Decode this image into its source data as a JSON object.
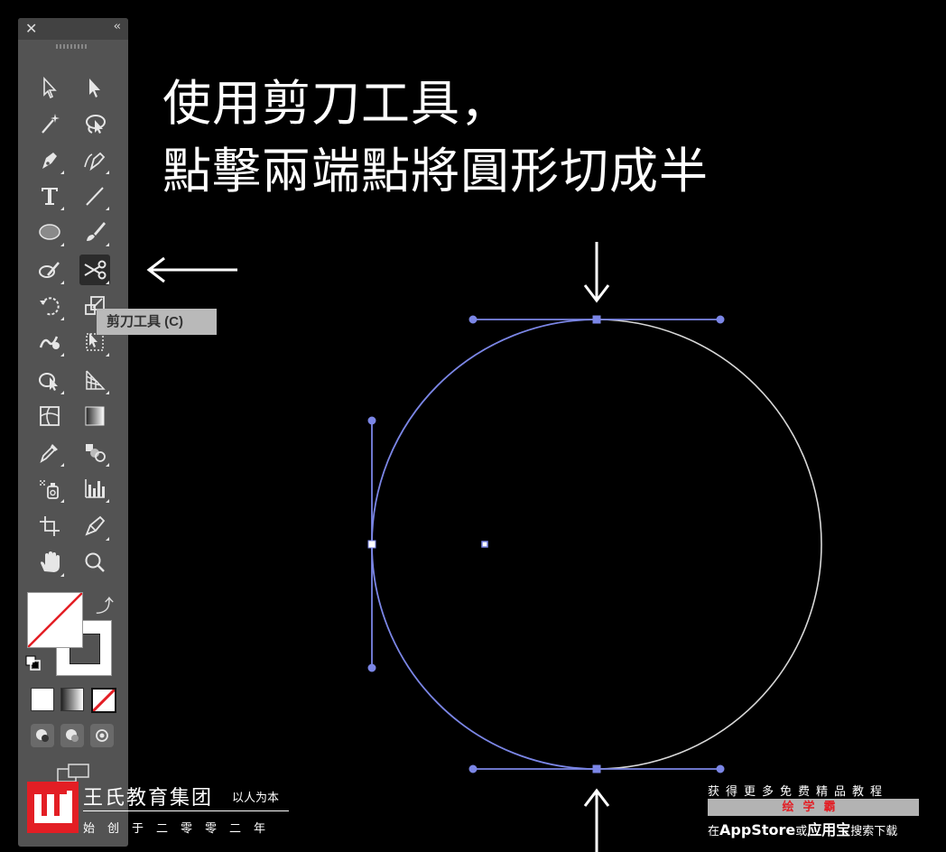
{
  "toolbar": {
    "close_glyph": "✕",
    "collapse_glyph": "‹‹",
    "tools": [
      {
        "name": "selection-tool",
        "icon": "arrow-outline-icon"
      },
      {
        "name": "direct-selection-tool",
        "icon": "arrow-solid-icon"
      },
      {
        "name": "magic-wand-tool",
        "icon": "magic-wand-icon"
      },
      {
        "name": "lasso-tool",
        "icon": "lasso-icon"
      },
      {
        "name": "pen-tool",
        "icon": "pen-icon"
      },
      {
        "name": "curvature-tool",
        "icon": "curvature-pen-icon"
      },
      {
        "name": "type-tool",
        "icon": "type-icon"
      },
      {
        "name": "line-tool",
        "icon": "line-icon"
      },
      {
        "name": "ellipse-tool",
        "icon": "ellipse-icon"
      },
      {
        "name": "paintbrush-tool",
        "icon": "paintbrush-icon"
      },
      {
        "name": "shaper-tool",
        "icon": "shaper-icon"
      },
      {
        "name": "scissors-tool",
        "icon": "scissors-icon",
        "active": true
      },
      {
        "name": "rotate-tool",
        "icon": "rotate-icon"
      },
      {
        "name": "scale-tool",
        "icon": "scale-icon"
      },
      {
        "name": "warp-tool",
        "icon": "warp-icon"
      },
      {
        "name": "free-transform-tool",
        "icon": "free-transform-icon"
      },
      {
        "name": "shape-builder-tool",
        "icon": "shape-builder-icon"
      },
      {
        "name": "perspective-grid-tool",
        "icon": "perspective-grid-icon"
      },
      {
        "name": "mesh-tool",
        "icon": "mesh-icon"
      },
      {
        "name": "gradient-tool",
        "icon": "gradient-icon"
      },
      {
        "name": "eyedropper-tool",
        "icon": "eyedropper-icon"
      },
      {
        "name": "blend-tool",
        "icon": "blend-icon"
      },
      {
        "name": "symbol-sprayer-tool",
        "icon": "symbol-sprayer-icon"
      },
      {
        "name": "column-graph-tool",
        "icon": "column-graph-icon"
      },
      {
        "name": "artboard-tool",
        "icon": "artboard-icon"
      },
      {
        "name": "slice-tool",
        "icon": "slice-icon"
      },
      {
        "name": "hand-tool",
        "icon": "hand-icon"
      },
      {
        "name": "zoom-tool",
        "icon": "zoom-icon"
      }
    ],
    "tooltip": "剪刀工具 (C)"
  },
  "instruction": {
    "line1": "使用剪刀工具，",
    "line2": "點擊兩端點將圓形切成半"
  },
  "watermark": {
    "brand": "王氏教育集团",
    "slogan": "以人为本",
    "sub": "始创于二零零二年"
  },
  "promo": {
    "line1": "获得更多免费精品教程",
    "app_name": "绘学霸",
    "line3_a": "在",
    "line3_b": "AppStore",
    "line3_c": "或",
    "line3_d": "应用宝",
    "line3_e": "搜索下载"
  },
  "colors": {
    "path_selected": "#7b86e6",
    "path_plain": "#d8d8d8",
    "toolbar_bg": "#535353",
    "logo_red": "#e31e24"
  }
}
